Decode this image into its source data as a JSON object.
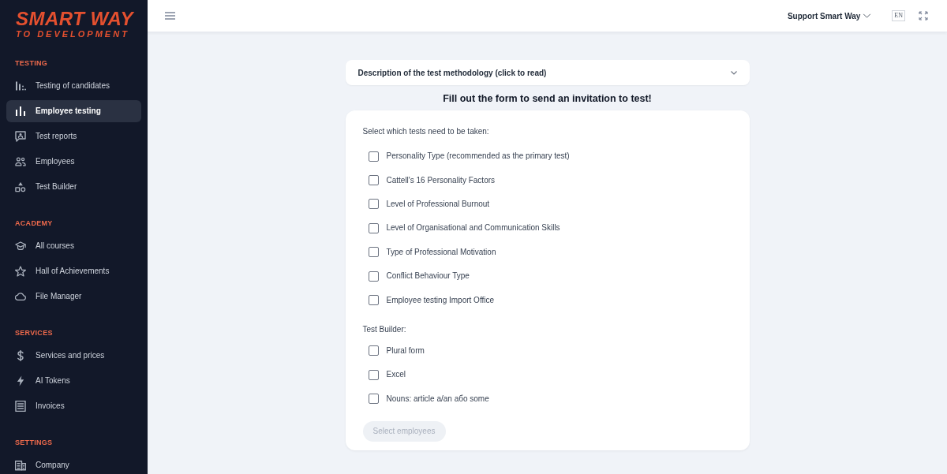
{
  "sidebar": {
    "logo": {
      "line_1": "SMART WAY",
      "line_2": "TO DEVELOPMENT"
    },
    "sections": [
      {
        "title": "TESTING",
        "items": [
          {
            "label": "Testing of candidates",
            "selected": false
          },
          {
            "label": "Employee testing",
            "selected": true
          },
          {
            "label": "Test reports",
            "selected": false
          },
          {
            "label": "Employees",
            "selected": false
          },
          {
            "label": "Test Builder",
            "selected": false
          }
        ]
      },
      {
        "title": "ACADEMY",
        "items": [
          {
            "label": "All courses",
            "selected": false
          },
          {
            "label": "Hall of Achievements",
            "selected": false
          },
          {
            "label": "File Manager",
            "selected": false
          }
        ]
      },
      {
        "title": "SERVICES",
        "items": [
          {
            "label": "Services and prices",
            "selected": false
          },
          {
            "label": "AI Tokens",
            "selected": false
          },
          {
            "label": "Invoices",
            "selected": false
          }
        ]
      },
      {
        "title": "SETTINGS",
        "items": [
          {
            "label": "Company",
            "selected": false
          }
        ]
      }
    ]
  },
  "header": {
    "support": "Support Smart Way",
    "language": "EN"
  },
  "accordion": {
    "title": "Description of the test methodology (click to read)",
    "expanded": false
  },
  "heading": "Fill out the form to send an invitation to test!",
  "form": {
    "groups": [
      {
        "label": "Select which tests need to be taken:",
        "options": [
          {
            "label": "Personality Type (recommended as the primary test)",
            "checked": false
          },
          {
            "label": "Cattell's 16 Personality Factors",
            "checked": false
          },
          {
            "label": "Level of Professional Burnout",
            "checked": false
          },
          {
            "label": "Level of Organisational and Communication Skills",
            "checked": false
          },
          {
            "label": "Type of Professional Motivation",
            "checked": false
          },
          {
            "label": "Conflict Behaviour Type",
            "checked": false
          },
          {
            "label": "Employee testing Import Office",
            "checked": false
          }
        ]
      },
      {
        "label": "Test Builder:",
        "options": [
          {
            "label": "Plural form",
            "checked": false
          },
          {
            "label": "Excel",
            "checked": false
          },
          {
            "label": "Nouns: article a/an або some",
            "checked": false
          }
        ]
      }
    ],
    "button": {
      "label": "Select employees",
      "disabled": true
    }
  }
}
